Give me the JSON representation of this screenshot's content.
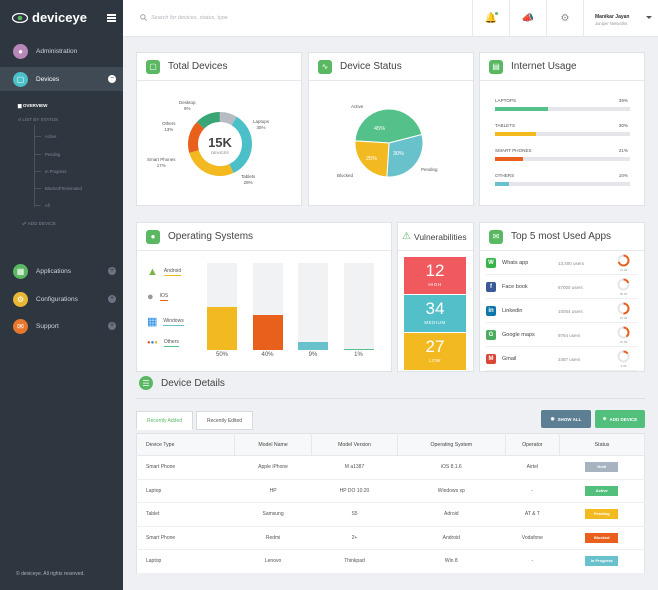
{
  "app": {
    "name": "deviceye",
    "copyright": "© deviceye. All rights reserved."
  },
  "sidebar": {
    "items": [
      {
        "label": "Administration",
        "color": "#b886b9"
      },
      {
        "label": "Devices",
        "color": "#4bc0c8"
      },
      {
        "label": "Applications",
        "color": "#5ab862"
      },
      {
        "label": "Configurations",
        "color": "#e8b834"
      },
      {
        "label": "Support",
        "color": "#e8762c"
      }
    ],
    "devices_sub": {
      "overview": "OVERVIEW",
      "list_by_status": "LIST BY STATUS",
      "statuses": [
        "Active",
        "Pending",
        "In Progress",
        "Blocked/Terminated",
        "All"
      ],
      "add_device": "ADD DEVICE"
    }
  },
  "topbar": {
    "search_placeholder": "Search for devices, status, type",
    "user_name": "Manikar Jayan",
    "user_org": "Juniper Networks"
  },
  "total_devices": {
    "title": "Total Devices",
    "center_value": "15K",
    "center_label": "DEVICES",
    "slices": [
      {
        "name": "Laptops",
        "value": 35,
        "label": "Laptops\n35%",
        "color": "#4bc0c8"
      },
      {
        "name": "Tablets",
        "value": 28,
        "label": "Tablets\n28%",
        "color": "#f2b920"
      },
      {
        "name": "Smart Phones",
        "value": 17,
        "label": "Smart Phones\n17%",
        "color": "#e8601c"
      },
      {
        "name": "Others",
        "value": 13,
        "label": "Others\n13%",
        "color": "#3aa676"
      },
      {
        "name": "Desktop",
        "value": 9,
        "label": "Desktop\n9%",
        "color": "#b7bcc2"
      }
    ]
  },
  "device_status": {
    "title": "Device Status",
    "slices": [
      {
        "name": "Active",
        "value": 45,
        "pct": "45%",
        "color": "#55c18a"
      },
      {
        "name": "Pending",
        "value": 30,
        "pct": "30%",
        "color": "#69c1cc"
      },
      {
        "name": "Blocked",
        "value": 25,
        "pct": "25%",
        "color": "#f2b920"
      }
    ]
  },
  "internet_usage": {
    "title": "Internet Usage",
    "rows": [
      {
        "label": "LAPTOPS",
        "pct": "39%",
        "value": 39,
        "color": "#55c18a"
      },
      {
        "label": "TABLETS",
        "pct": "30%",
        "value": 30,
        "color": "#f2b920"
      },
      {
        "label": "SMART PHONES",
        "pct": "21%",
        "value": 21,
        "color": "#e8601c"
      },
      {
        "label": "OTHERS",
        "pct": "10%",
        "value": 10,
        "color": "#69c1cc"
      }
    ]
  },
  "operating_systems": {
    "title": "Operating Systems",
    "items": [
      {
        "name": "Android",
        "color": "#f2b920"
      },
      {
        "name": "IOS",
        "color": "#e8601c"
      },
      {
        "name": "Windows",
        "color": "#69c1cc"
      },
      {
        "name": "Others",
        "color": "#55c18a"
      }
    ]
  },
  "chart_data": {
    "type": "bar",
    "categories": [
      "Android",
      "IOS",
      "Windows",
      "Others"
    ],
    "values": [
      50,
      40,
      9,
      1
    ],
    "labels": [
      "50%",
      "40%",
      "9%",
      "1%"
    ],
    "ylim": [
      0,
      100
    ],
    "colors": [
      "#f2b920",
      "#e8601c",
      "#69c1cc",
      "#55c18a"
    ]
  },
  "vulnerabilities": {
    "title": "Vulnerabilities",
    "items": [
      {
        "value": "12",
        "label": "HIGH",
        "color": "#f05a5e"
      },
      {
        "value": "34",
        "label": "MEDIUM",
        "color": "#52bfc9"
      },
      {
        "value": "27",
        "label": "LOW",
        "color": "#f2b920"
      }
    ]
  },
  "top_apps": {
    "title": "Top 5 most Used Apps",
    "items": [
      {
        "name": "Whats app",
        "users": "13,400 users",
        "ring_label": "12.08",
        "share": 70,
        "icon": "W",
        "color": "#37b34a"
      },
      {
        "name": "Face book",
        "users": "67000 users",
        "ring_label": "90.00",
        "share": 20,
        "icon": "f",
        "color": "#3b5998"
      },
      {
        "name": "Linkedin",
        "users": "10054 users",
        "ring_label": "15.08",
        "share": 50,
        "icon": "in",
        "color": "#0e76a8"
      },
      {
        "name": "Google maps",
        "users": "9784 users",
        "ring_label": "20.08",
        "share": 40,
        "icon": "G",
        "color": "#4bab5e"
      },
      {
        "name": "Gmail",
        "users": "2487 users",
        "ring_label": "9.08",
        "share": 15,
        "icon": "M",
        "color": "#db4437"
      }
    ]
  },
  "device_details": {
    "title": "Device Details",
    "tabs": [
      "Recently Added",
      "Recently Edited"
    ],
    "show_all": "SHOW ALL",
    "add_device": "ADD DEVICE",
    "columns": [
      "Device Type",
      "Model Name",
      "Model Version",
      "Operating System",
      "Operator",
      "Status"
    ],
    "rows": [
      [
        "Smart Phone",
        "Apple iPhone",
        "M a1387",
        "iOS 8.1.6",
        "Airtel",
        "Hold"
      ],
      [
        "Laptop",
        "HP",
        "HP DO 10:20",
        "Windows xp",
        "-",
        "Active"
      ],
      [
        "Tablet",
        "Samsung",
        "S5",
        "Adroid",
        "AT & T",
        "Pending"
      ],
      [
        "Smart Phone",
        "Redmi",
        "2+",
        "Android",
        "Vodafone",
        "Blocked"
      ],
      [
        "Laptop",
        "Lenovo",
        "Thinkpad",
        "Win 8",
        "-",
        "In Progress"
      ]
    ],
    "status_colors": {
      "Hold": "#a7b3c0",
      "Active": "#52c07c",
      "Pending": "#f2b920",
      "Blocked": "#e8601c",
      "In Progress": "#69c1cc"
    }
  }
}
